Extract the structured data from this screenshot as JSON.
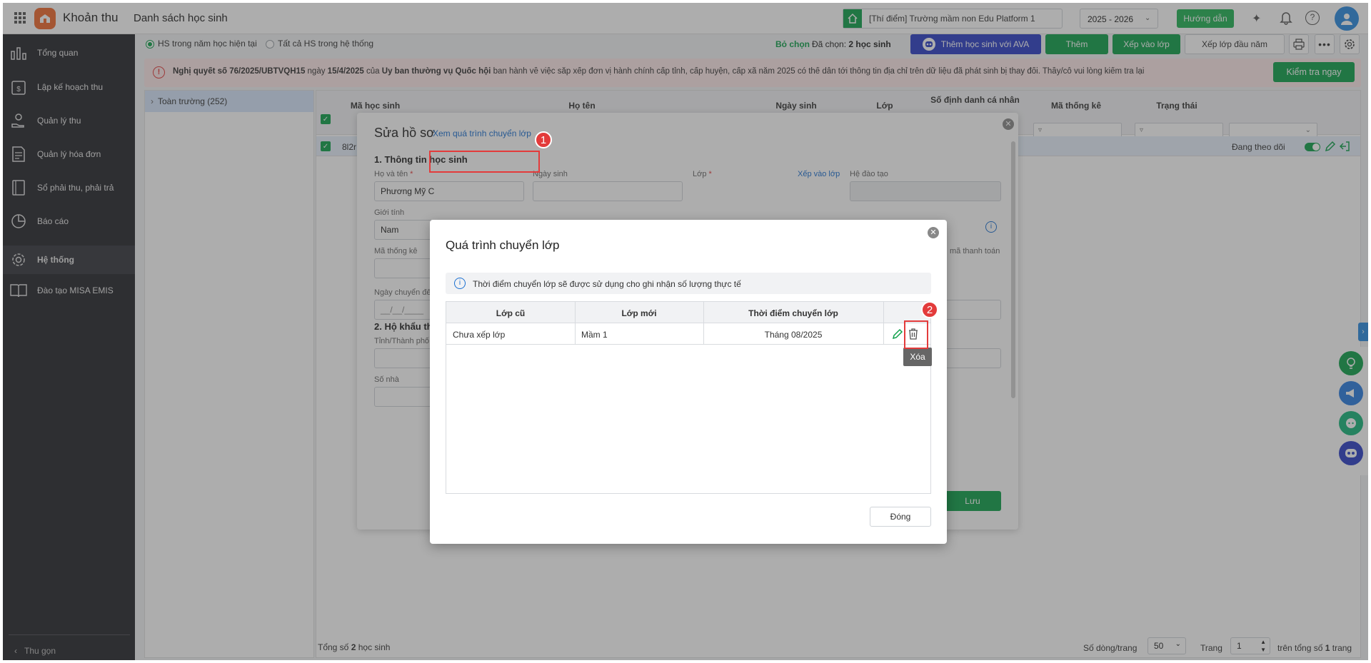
{
  "app": {
    "name": "Khoản thu",
    "page_title": "Danh sách học sinh",
    "school": "[Thí điểm] Trường mầm non Edu Platform 1",
    "year": "2025 - 2026",
    "guide": "Hướng dẫn"
  },
  "sidebar": {
    "items": [
      {
        "label": "Tổng quan",
        "icon": "bar-chart-icon"
      },
      {
        "label": "Lập kế hoạch thu",
        "icon": "calendar-dollar-icon"
      },
      {
        "label": "Quản lý thu",
        "icon": "hand-coin-icon"
      },
      {
        "label": "Quản lý hóa đơn",
        "icon": "invoice-icon"
      },
      {
        "label": "Sổ phải thu, phải trả",
        "icon": "ledger-icon"
      },
      {
        "label": "Báo cáo",
        "icon": "pie-chart-icon"
      },
      {
        "label": "Hệ thống",
        "icon": "gear-icon"
      },
      {
        "label": "Đào tạo MISA EMIS",
        "icon": "book-icon"
      }
    ],
    "collapse": "Thu gọn"
  },
  "toolbar": {
    "radio_current": "HS trong năm học hiện tại",
    "radio_all": "Tất cả HS trong hệ thống",
    "deselect": "Bỏ chọn",
    "selected_prefix": "Đã chọn:",
    "selected_count": "2 học sinh",
    "ava_btn": "Thêm học sinh với AVA",
    "add_btn": "Thêm",
    "assign_btn": "Xếp vào lớp",
    "first_assign_btn": "Xếp lớp đầu năm"
  },
  "notice": {
    "bold1": "Nghị quyết số 76/2025/UBTVQH15",
    "t1": " ngày ",
    "bold2": "15/4/2025",
    "t2": " của ",
    "bold3": "Ủy ban thường vụ Quốc hội",
    "t3": " ban hành về việc sắp xếp đơn vị hành chính cấp tỉnh, cấp huyện, cấp xã năm 2025 có thể dẫn tới thông tin địa chỉ trên dữ liệu đã phát sinh bị thay đổi. Thầy/cô vui lòng kiểm tra lại.",
    "check_btn": "Kiểm tra ngay"
  },
  "tree": {
    "root": "Toàn trường (252)"
  },
  "table": {
    "headers": [
      "Mã học sinh",
      "Họ tên",
      "Ngày sinh",
      "Lớp",
      "Số định danh cá nhân",
      "Mã thống kê",
      "Trạng thái"
    ],
    "row_id": "8l2r",
    "row_status": "Đang theo dõi",
    "total_prefix": "Tổng số",
    "total_count": "2",
    "total_suffix": "học sinh",
    "rows_per_page_label": "Số dòng/trang",
    "rows_per_page": "50",
    "page_label": "Trang",
    "page": "1",
    "of_total": "trên tổng số",
    "total_pages": "1",
    "pages_suffix": "trang"
  },
  "edit_dialog": {
    "title": "Sửa hồ sơ",
    "history_link": "Xem quá trình chuyển lớp",
    "section1": "1. Thông tin học sinh",
    "name_label": "Họ và tên",
    "name_value": "Phương Mỹ C",
    "dob_label": "Ngày sinh",
    "class_label": "Lớp",
    "assign_link": "Xếp vào lớp",
    "system_label": "Hệ đào tạo",
    "gender_label": "Giới tính",
    "gender_value": "Nam",
    "stat_label": "Mã thống kê",
    "pay_code_label": "mã thanh toán",
    "transfer_date_label": "Ngày chuyển đế",
    "transfer_date_placeholder": "__/__/____",
    "section2": "2. Hộ khẩu thư",
    "province_label": "Tỉnh/Thành phố",
    "house_label": "Số nhà",
    "save_btn": "Lưu"
  },
  "history_dialog": {
    "title": "Quá trình chuyển lớp",
    "info": "Thời điểm chuyển lớp sẽ được sử dụng cho ghi nhận số lượng thực tế",
    "columns": [
      "Lớp cũ",
      "Lớp mới",
      "Thời điểm chuyển lớp"
    ],
    "rows": [
      {
        "old": "Chưa xếp lớp",
        "new": "Mầm 1",
        "time": "Tháng 08/2025"
      }
    ],
    "tooltip": "Xóa",
    "close_btn": "Đóng"
  },
  "annotations": [
    "1",
    "2"
  ],
  "colors": {
    "green": "#0fa14a",
    "blue": "#2b3ec7",
    "sidebar": "#25262c",
    "annotation_red": "#e33b3b"
  }
}
